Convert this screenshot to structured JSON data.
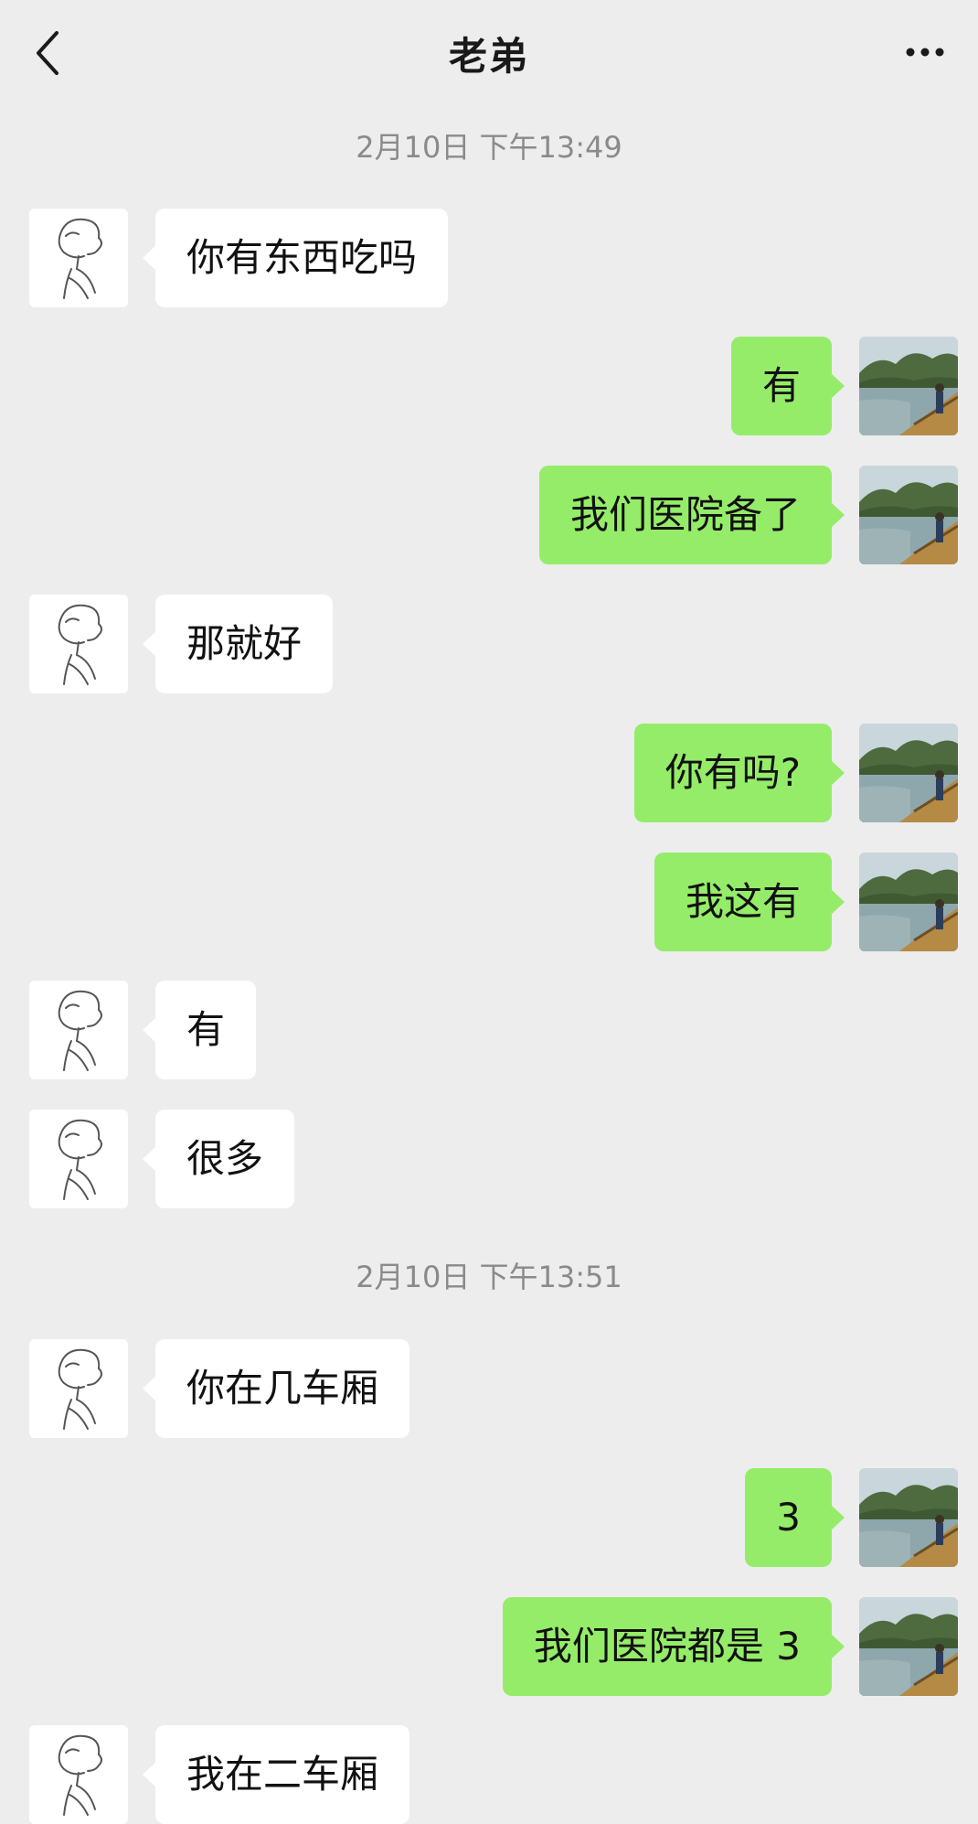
{
  "header": {
    "title": "老弟",
    "back_icon": "chevron-left-icon",
    "more_icon": "more-dots-icon"
  },
  "timestamps": [
    "2月10日 下午13:49",
    "2月10日 下午13:51"
  ],
  "messages": [
    {
      "from": "contact",
      "text": "你有东西吃吗"
    },
    {
      "from": "me",
      "text": "有"
    },
    {
      "from": "me",
      "text": "我们医院备了"
    },
    {
      "from": "contact",
      "text": "那就好"
    },
    {
      "from": "me",
      "text": "你有吗?"
    },
    {
      "from": "me",
      "text": "我这有"
    },
    {
      "from": "contact",
      "text": "有"
    },
    {
      "from": "contact",
      "text": "很多"
    },
    {
      "from": "contact",
      "text": "你在几车厢"
    },
    {
      "from": "me",
      "text": "3"
    },
    {
      "from": "me",
      "text": "我们医院都是 3"
    },
    {
      "from": "contact",
      "text": "我在二车厢"
    }
  ],
  "colors": {
    "background": "#ededed",
    "outgoing_bubble": "#95ec69",
    "incoming_bubble": "#ffffff",
    "timestamp_text": "#8a8a8a"
  }
}
